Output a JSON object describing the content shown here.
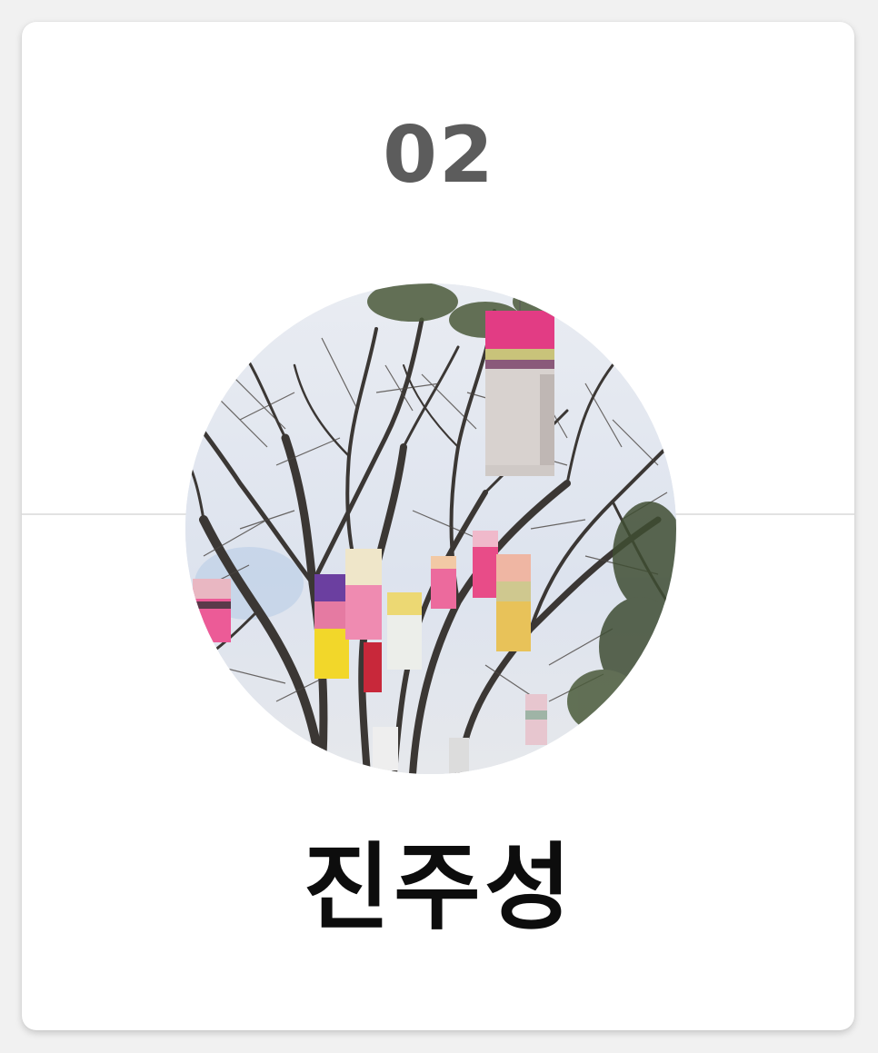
{
  "number": "02",
  "title": "진주성",
  "photo": {
    "icon": "lanterns-in-tree-photo",
    "sky_color": "#dfe4ee",
    "branch_color": "#3b3734"
  }
}
